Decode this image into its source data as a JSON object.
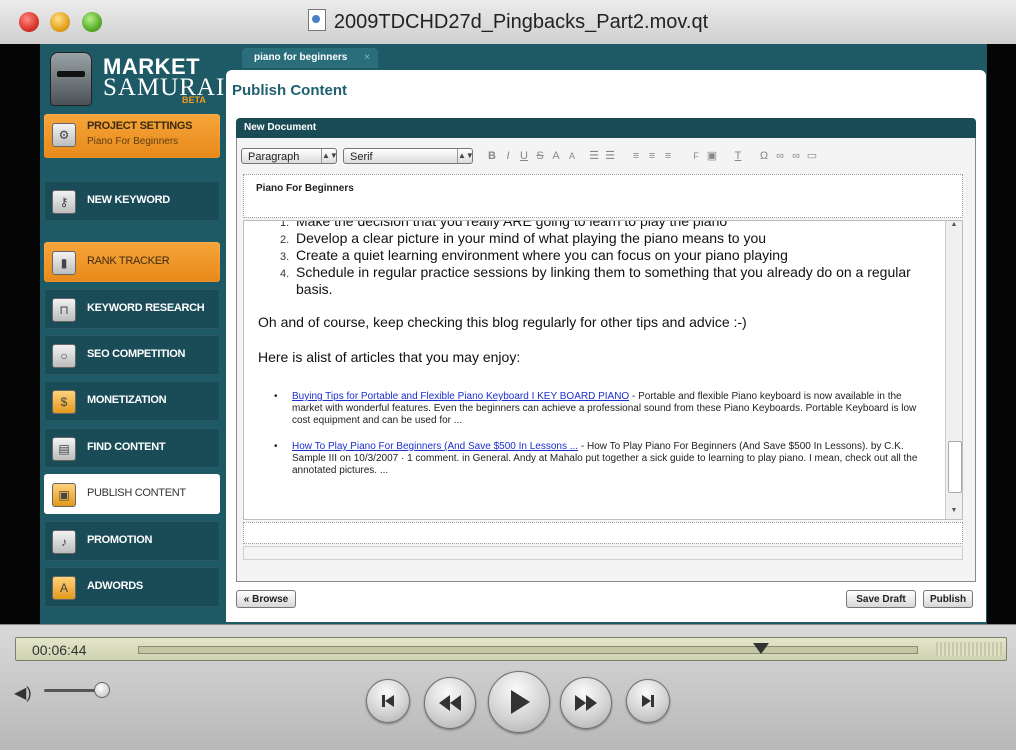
{
  "window": {
    "title": "2009TDCHD27d_Pingbacks_Part2.mov.qt"
  },
  "logo": {
    "line1": "MARKET",
    "line2": "SAMURAI",
    "badge": "BETA"
  },
  "sidebar": {
    "project": {
      "label": "PROJECT SETTINGS",
      "value": "Piano For Beginners"
    },
    "items": [
      {
        "label": "NEW KEYWORD",
        "icon": "key-icon"
      },
      {
        "label": "RANK TRACKER",
        "icon": "bar-chart-icon"
      },
      {
        "label": "KEYWORD RESEARCH",
        "icon": "lock-icon"
      },
      {
        "label": "SEO COMPETITION",
        "icon": "magnifier-icon"
      },
      {
        "label": "MONETIZATION",
        "icon": "dollar-icon"
      },
      {
        "label": "FIND CONTENT",
        "icon": "document-icon"
      },
      {
        "label": "PUBLISH CONTENT",
        "icon": "publish-icon"
      },
      {
        "label": "PROMOTION",
        "icon": "microphone-icon"
      },
      {
        "label": "ADWORDS",
        "icon": "adwords-icon"
      }
    ]
  },
  "tab": {
    "label": "piano for beginners",
    "close": "×"
  },
  "panel": {
    "title": "Publish Content",
    "doc_header": "New Document"
  },
  "toolbar": {
    "format": "Paragraph",
    "font": "Serif"
  },
  "editor": {
    "title": "Piano For Beginners",
    "list_items": [
      "Make the decision that you really ARE going to learn to play the piano",
      "Develop a clear picture in your mind of what playing the piano means to you",
      "Create a quiet learning environment where you can focus on your piano playing",
      "Schedule in regular practice sessions by linking them to something that you already do on a regular basis."
    ],
    "list_numbers": [
      "1.",
      "2.",
      "3.",
      "4."
    ],
    "para1": "Oh and of course, keep checking this blog regularly for other tips and advice :-)",
    "para2": "Here is alist of articles that you may enjoy:",
    "articles": [
      {
        "link": "Buying Tips for Portable and Flexible Piano Keyboard I KEY BOARD PIANO",
        "text": " - Portable and flexible Piano keyboard is now available in the market with wonderful features. Even the beginners can achieve a professional sound from these Piano Keyboards. Portable Keyboard is low cost equipment and can be used for ..."
      },
      {
        "link": "How To Play Piano For Beginners (And Save $500 In Lessons ...",
        "text": " - How To Play Piano For Beginners (And Save $500 In Lessons). by C.K. Sample III on 10/3/2007 · 1 comment. in General. Andy at Mahalo put together a sick guide to learning to play piano. I mean, check out all the annotated pictures. ..."
      }
    ]
  },
  "buttons": {
    "browse": "« Browse",
    "save_draft": "Save Draft",
    "publish": "Publish"
  },
  "player": {
    "time": "00:06:44",
    "progress": 0.8
  },
  "colors": {
    "accent_orange": "#f39b1e",
    "teal": "#1d5a66",
    "link": "#1c2fd1"
  }
}
